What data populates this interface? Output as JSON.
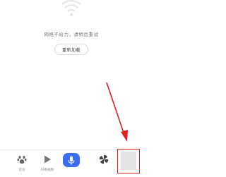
{
  "error": {
    "message": "网络不给力，请稍后重试",
    "reload_label": "重新加载"
  },
  "bottom_nav": {
    "items": [
      {
        "label": "首页",
        "icon": "paw-icon"
      },
      {
        "label": "好看视频",
        "icon": "play-icon"
      },
      {
        "label": "",
        "icon": "microphone-icon"
      },
      {
        "label": "",
        "icon": "pinwheel-icon"
      },
      {
        "label": "",
        "icon": "person-icon"
      }
    ]
  },
  "colors": {
    "accent": "#3a6df0",
    "annotation": "#e02020"
  }
}
